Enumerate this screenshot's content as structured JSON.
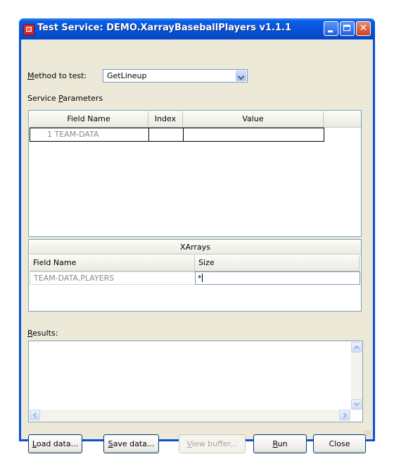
{
  "window": {
    "title": "Test Service: DEMO.XarrayBaseballPlayers v1.1.1",
    "controls": {
      "minimize": "minimize-icon",
      "maximize": "maximize-icon",
      "close": "close-icon"
    }
  },
  "method": {
    "label_pre": "",
    "label_mnemonic": "M",
    "label_post": "ethod to test:",
    "selected": "GetLineup"
  },
  "params": {
    "label_pre": "Service ",
    "label_mnemonic": "P",
    "label_post": "arameters",
    "columns": [
      "Field Name",
      "Index",
      "Value"
    ],
    "rows": [
      {
        "field_name": "1 TEAM-DATA",
        "index": "",
        "value": ""
      }
    ]
  },
  "xarrays": {
    "title": "XArrays",
    "columns": [
      "Field Name",
      "Size"
    ],
    "rows": [
      {
        "field_name": "TEAM-DATA.PLAYERS",
        "size": "*"
      }
    ]
  },
  "results": {
    "label_mnemonic": "R",
    "label_post": "esults:",
    "content": ""
  },
  "buttons": {
    "load": {
      "mnemonic": "L",
      "rest": "oad data..."
    },
    "save": {
      "mnemonic": "S",
      "rest": "ave data..."
    },
    "view": {
      "mnemonic": "V",
      "rest": "iew buffer..."
    },
    "run": {
      "mnemonic": "R",
      "rest": "un"
    },
    "close": {
      "label": "Close"
    }
  },
  "colors": {
    "titlebar": "#0a5ee8",
    "dialog_bg": "#ece9d8",
    "close_button": "#d1421c"
  }
}
